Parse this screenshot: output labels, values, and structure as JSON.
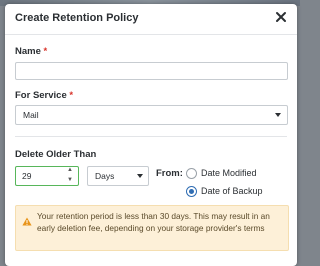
{
  "dialog": {
    "title": "Create Retention Policy",
    "close_icon": "close-icon"
  },
  "form": {
    "name": {
      "label": "Name",
      "required_mark": "*",
      "value": "",
      "placeholder": ""
    },
    "service": {
      "label": "For Service",
      "required_mark": "*",
      "selected": "Mail"
    },
    "delete_older_than": {
      "label": "Delete Older Than",
      "amount": "29",
      "unit": "Days",
      "from_label": "From:",
      "options": [
        {
          "label": "Date Modified",
          "checked": false
        },
        {
          "label": "Date of Backup",
          "checked": true
        }
      ]
    }
  },
  "alert": {
    "icon": "warning-icon",
    "text": "Your retention period is less than 30 days. This may result in an early deletion fee, depending on your storage provider's terms"
  },
  "colors": {
    "accent": "#2f6db3",
    "required": "#d9342b",
    "warning_bg": "#fdf0d8",
    "warning_icon": "#e8941a",
    "valid_border": "#57b65a"
  }
}
